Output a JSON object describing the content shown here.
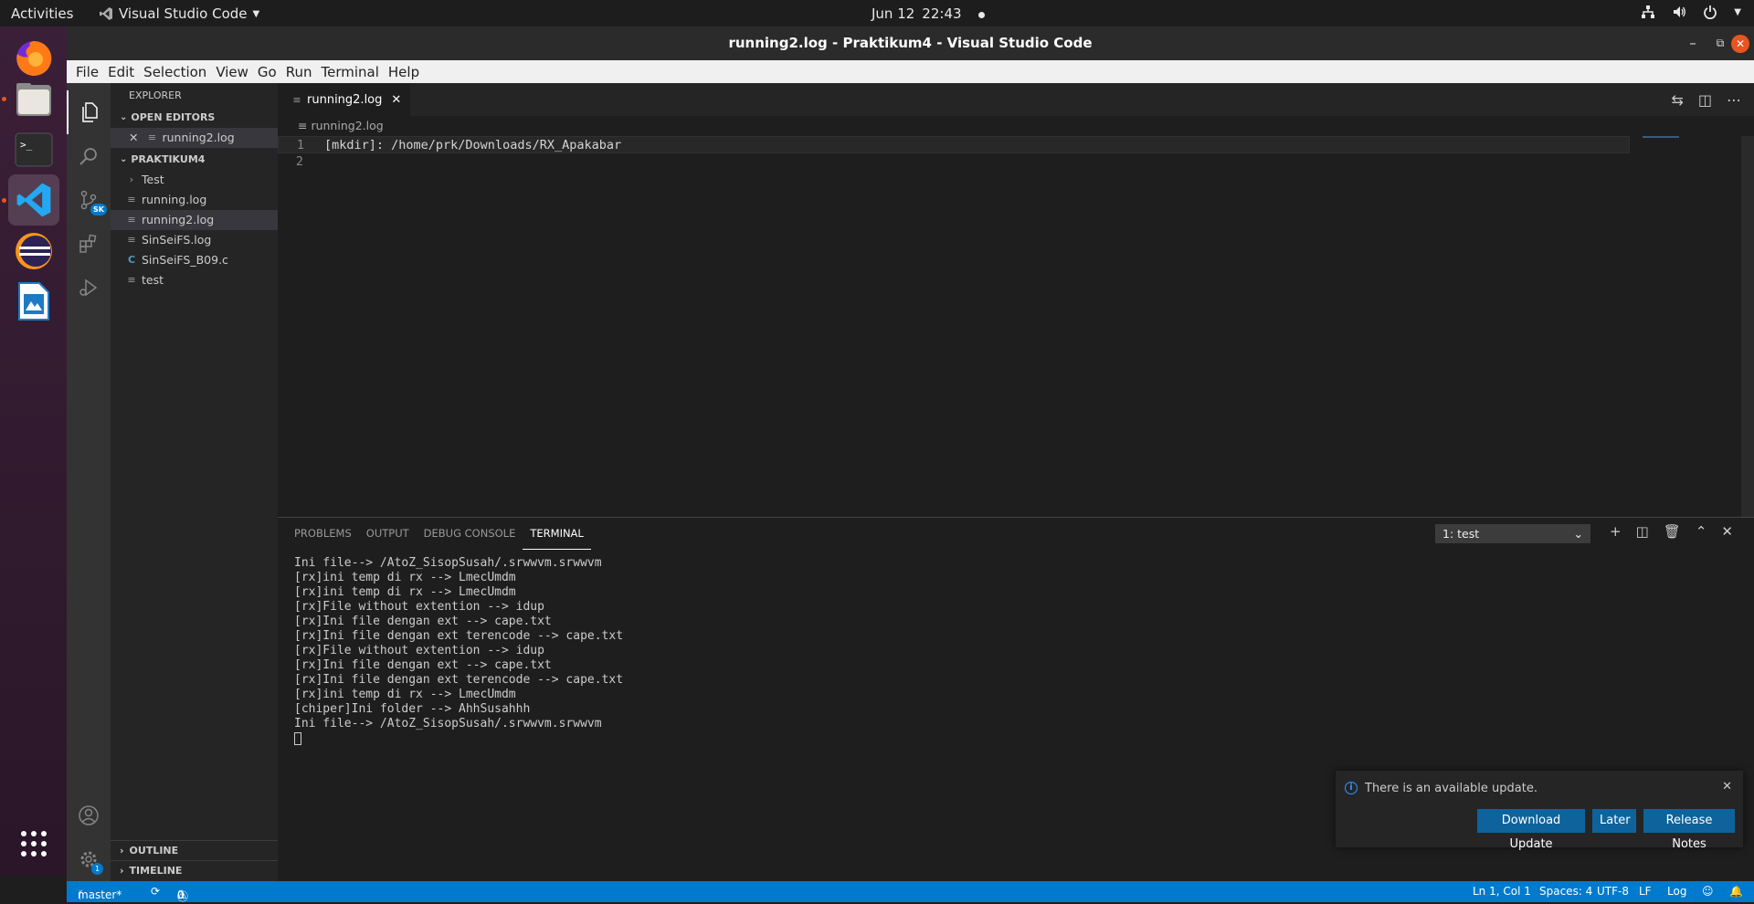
{
  "top_bar": {
    "activities": "Activities",
    "app_name": "Visual Studio Code",
    "date": "Jun 12",
    "time": "22:43"
  },
  "window": {
    "title": "running2.log - Praktikum4 - Visual Studio Code"
  },
  "menu": [
    "File",
    "Edit",
    "Selection",
    "View",
    "Go",
    "Run",
    "Terminal",
    "Help"
  ],
  "explorer": {
    "title": "EXPLORER",
    "open_editors_header": "OPEN EDITORS",
    "open_editor_file": "running2.log",
    "project_header": "PRAKTIKUM4",
    "items": [
      {
        "label": "Test",
        "icon": "chevron-right-icon"
      },
      {
        "label": "running.log",
        "icon": "lines-icon"
      },
      {
        "label": "running2.log",
        "icon": "lines-icon"
      },
      {
        "label": "SinSeiFS.log",
        "icon": "lines-icon"
      },
      {
        "label": "SinSeiFS_B09.c",
        "icon": "c-icon"
      },
      {
        "label": "test",
        "icon": "lines-icon"
      }
    ],
    "outline": "OUTLINE",
    "timeline": "TIMELINE"
  },
  "scm_badge": "SK",
  "settings_badge": "1",
  "editor": {
    "tab_label": "running2.log",
    "breadcrumb": "running2.log",
    "lines": [
      {
        "num": "1",
        "text": "[mkdir]: /home/prk/Downloads/RX_Apakabar"
      },
      {
        "num": "2",
        "text": ""
      }
    ]
  },
  "panel": {
    "tabs": [
      "PROBLEMS",
      "OUTPUT",
      "DEBUG CONSOLE",
      "TERMINAL"
    ],
    "terminal_select": "1: test",
    "terminal_lines": [
      "Ini file--> /AtoZ_SisopSusah/.srwwvm.srwwvm",
      "[rx]ini temp di rx --> LmecUmdm",
      "[rx]ini temp di rx --> LmecUmdm",
      "[rx]File without extention --> idup",
      "[rx]Ini file dengan ext --> cape.txt",
      "[rx]Ini file dengan ext terencode --> cape.txt",
      "[rx]File without extention --> idup",
      "[rx]Ini file dengan ext --> cape.txt",
      "[rx]Ini file dengan ext terencode --> cape.txt",
      "[rx]ini temp di rx --> LmecUmdm",
      "[chiper]Ini folder --> AhhSusahhh",
      "Ini file--> /AtoZ_SisopSusah/.srwwvm.srwwvm"
    ]
  },
  "notification": {
    "message": "There is an available update.",
    "download": "Download Update",
    "later": "Later",
    "release_notes": "Release Notes"
  },
  "status_bar": {
    "branch": "master*",
    "errors": "0",
    "warnings": "0",
    "position": "Ln 1, Col 1",
    "spaces": "Spaces: 4",
    "encoding": "UTF-8",
    "eol": "LF",
    "language": "Log"
  },
  "colors": {
    "accent": "#007acc",
    "ubuntu_orange": "#e95420",
    "button": "#0e639c"
  }
}
